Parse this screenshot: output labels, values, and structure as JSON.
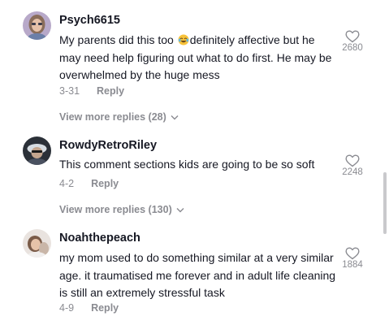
{
  "comments": [
    {
      "username": "Psych6615",
      "text_before_emoji": "My parents did this too ",
      "emoji": "face-with-tears-of-joy",
      "text_after_emoji": "definitely affective but he may need help figuring out what to do first. He may be overwhelmed by the huge mess",
      "date": "3-31",
      "reply_label": "Reply",
      "likes": "2680",
      "view_more_replies": "View more replies (28)"
    },
    {
      "username": "RowdyRetroRiley",
      "text": "This comment sections kids are going to be so soft",
      "date": "4-2",
      "reply_label": "Reply",
      "likes": "2248",
      "view_more_replies": "View more replies (130)"
    },
    {
      "username": "Noahthepeach",
      "text": "my mom used to do something similar at a very similar age. it traumatised me forever and in adult life cleaning is still an extremely stressful task",
      "date": "4-9",
      "reply_label": "Reply",
      "likes": "1884"
    }
  ],
  "icons": {
    "like": "heart-outline-icon",
    "expand": "chevron-down-icon"
  },
  "colors": {
    "text": "#161823",
    "muted": "#8a8b91",
    "background": "#ffffff"
  }
}
